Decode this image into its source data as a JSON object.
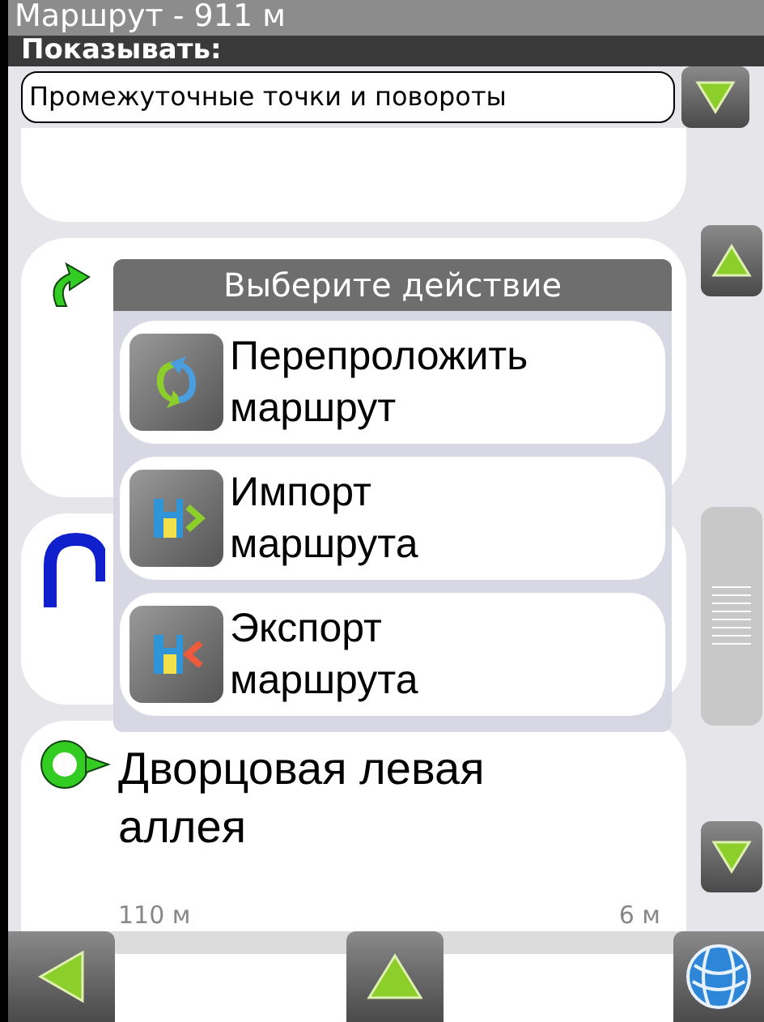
{
  "window": {
    "title": "Маршрут - 911 м"
  },
  "filter": {
    "label": "Показывать:",
    "value": "Промежуточные точки и повороты"
  },
  "route_items": [
    {
      "kind": "partial"
    },
    {
      "kind": "turn"
    },
    {
      "kind": "uturn"
    },
    {
      "kind": "roundabout",
      "name": "Дворцовая левая аллея",
      "distance": "110 м",
      "step": "6 м"
    }
  ],
  "dialog": {
    "title": "Выберите действие",
    "actions": [
      {
        "kind": "reroute",
        "label": "Перепроложить маршрут"
      },
      {
        "kind": "import",
        "label": "Импорт маршрута"
      },
      {
        "kind": "export",
        "label": "Экспорт маршрута"
      }
    ]
  },
  "scrollbar": {
    "level": 0.68
  }
}
